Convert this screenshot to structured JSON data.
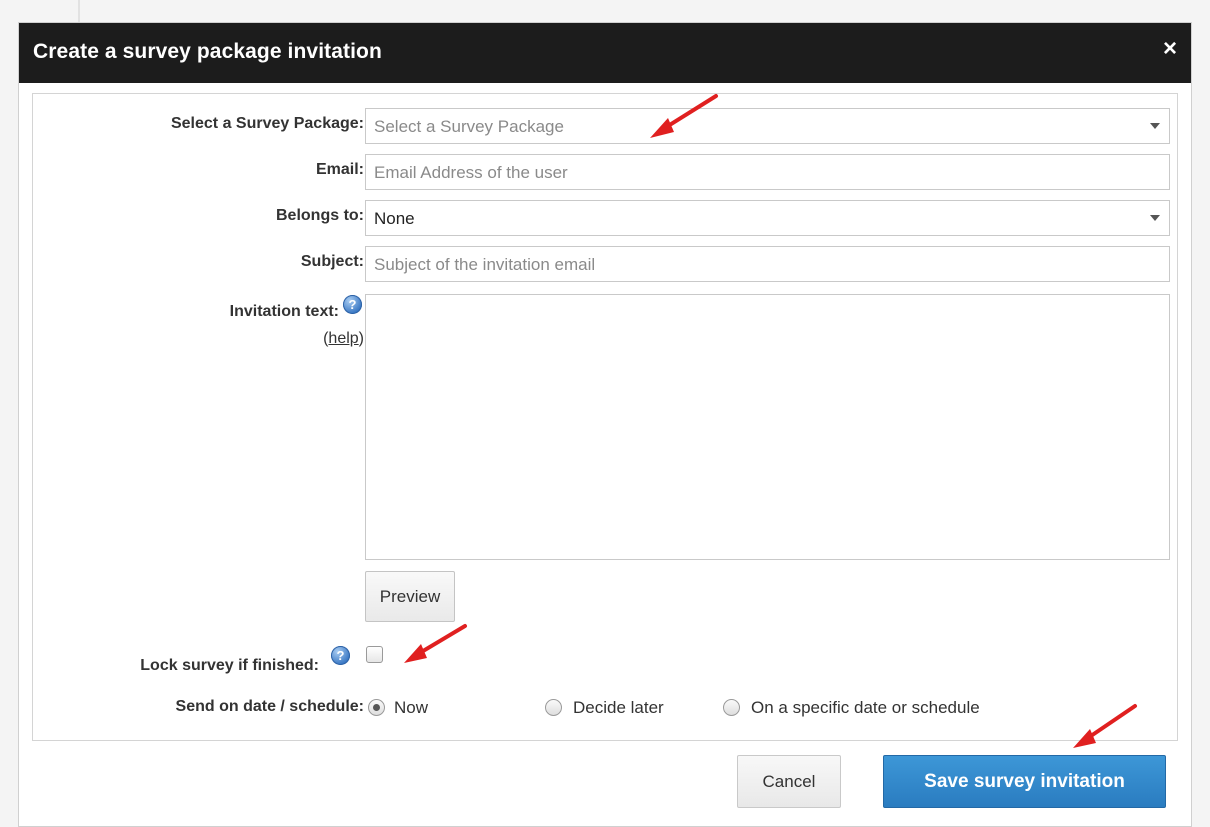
{
  "dialog": {
    "title": "Create a survey package invitation",
    "close_glyph": "×"
  },
  "form": {
    "survey_package": {
      "label": "Select a Survey Package:",
      "placeholder": "Select a Survey Package"
    },
    "email": {
      "label": "Email:",
      "placeholder": "Email Address of the user"
    },
    "belongs_to": {
      "label": "Belongs to:",
      "value": "None"
    },
    "subject": {
      "label": "Subject:",
      "placeholder": "Subject of the invitation email"
    },
    "invitation_text": {
      "label": "Invitation text:",
      "help_link_open": "(",
      "help_link": "help",
      "help_link_close": ")",
      "value": ""
    },
    "preview_label": "Preview",
    "lock_survey": {
      "label": "Lock survey if finished:",
      "checked": false
    },
    "send_schedule": {
      "label": "Send on date / schedule:",
      "options": [
        {
          "label": "Now",
          "checked": true
        },
        {
          "label": "Decide later",
          "checked": false
        },
        {
          "label": "On a specific date or schedule",
          "checked": false
        }
      ]
    }
  },
  "footer": {
    "cancel_label": "Cancel",
    "save_label": "Save survey invitation"
  },
  "icons": {
    "help": "question-circle-icon",
    "close": "close-icon",
    "dropdown": "chevron-down-icon"
  },
  "colors": {
    "titlebar": "#1c1c1c",
    "primary_button": "#2a7cc0",
    "annotation_arrow": "#e02020"
  }
}
